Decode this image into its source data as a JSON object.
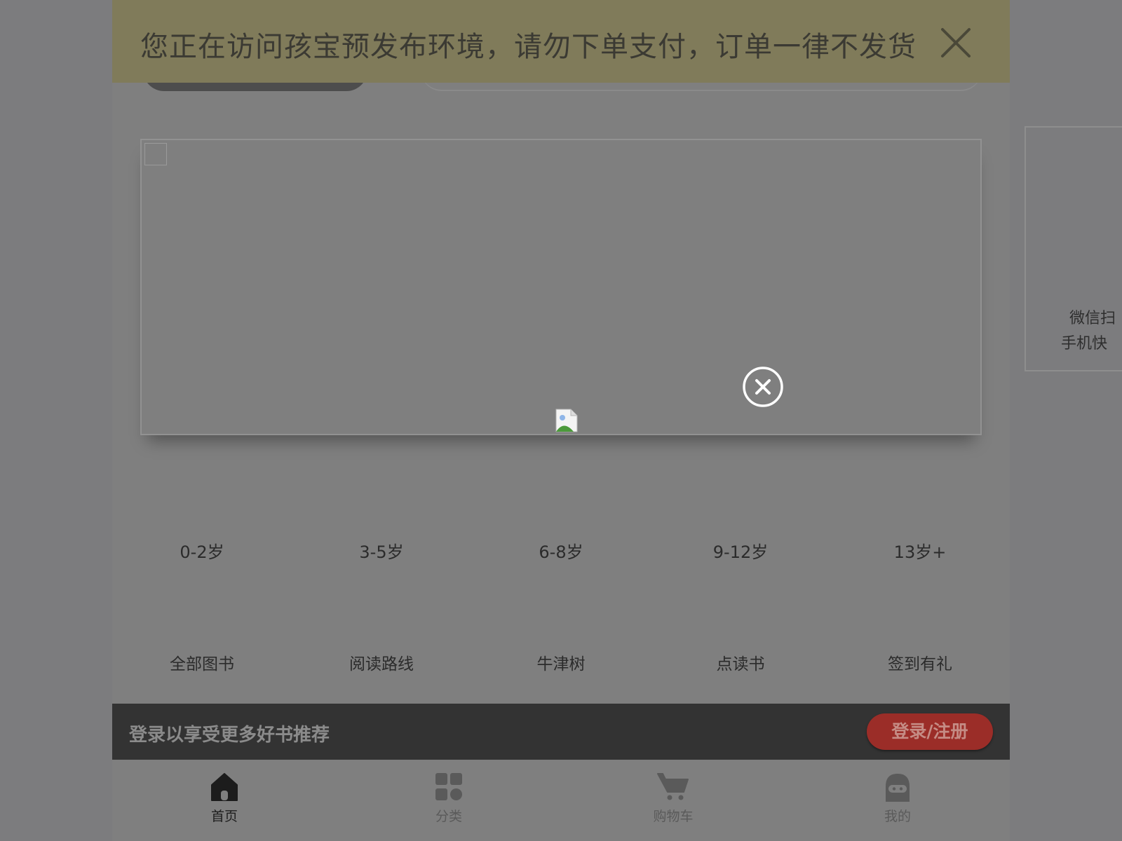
{
  "env_banner": {
    "text": "您正在访问孩宝预发布环境，请勿下单支付，订单一律不发货",
    "close_icon": "close-icon"
  },
  "carousel": {
    "close_icon": "circle-close-icon",
    "image_icon": "broken-image-icon"
  },
  "age_nav": [
    {
      "label": "0-2岁"
    },
    {
      "label": "3-5岁"
    },
    {
      "label": "6-8岁"
    },
    {
      "label": "9-12岁"
    },
    {
      "label": "13岁+"
    }
  ],
  "category_nav": [
    {
      "label": "全部图书"
    },
    {
      "label": "阅读路线"
    },
    {
      "label": "牛津树"
    },
    {
      "label": "点读书"
    },
    {
      "label": "签到有礼"
    }
  ],
  "login_bar": {
    "text": "登录以享受更多好书推荐",
    "button_label": "登录/注册",
    "button_color": "#9b2d28"
  },
  "tabbar": [
    {
      "label": "首页",
      "icon": "home-icon",
      "active": true
    },
    {
      "label": "分类",
      "icon": "grid-icon",
      "active": false
    },
    {
      "label": "购物车",
      "icon": "cart-icon",
      "active": false
    },
    {
      "label": "我的",
      "icon": "profile-icon",
      "active": false
    }
  ],
  "side_panel": {
    "line1": "微信扫",
    "line2": "手机快"
  },
  "colors": {
    "overlay": "#7f7f7f",
    "banner": "#807b5a"
  }
}
